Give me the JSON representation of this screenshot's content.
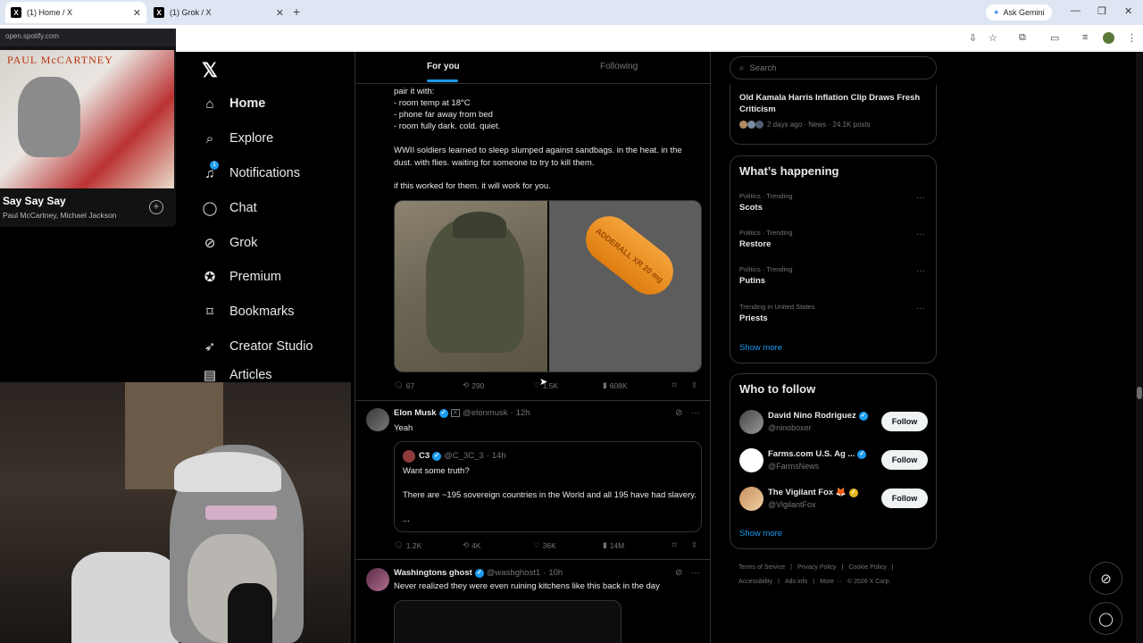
{
  "browser": {
    "tabs": [
      {
        "label": "(1) Home / X",
        "icon": "x-favicon"
      },
      {
        "label": "(1) Grok / X",
        "icon": "x-favicon"
      }
    ],
    "gemini_label": "Ask Gemini"
  },
  "spotify": {
    "url": "open.spotify.com",
    "art_text": "PAUL McCARTNEY",
    "song": "Say Say Say",
    "artist": "Paul McCartney, Michael Jackson"
  },
  "nav": {
    "items": [
      {
        "label": "Home",
        "icon": "home-icon"
      },
      {
        "label": "Explore",
        "icon": "search-icon"
      },
      {
        "label": "Notifications",
        "icon": "bell-icon",
        "badge": "1"
      },
      {
        "label": "Chat",
        "icon": "chat-icon"
      },
      {
        "label": "Grok",
        "icon": "grok-icon"
      },
      {
        "label": "Premium",
        "icon": "premium-icon"
      },
      {
        "label": "Bookmarks",
        "icon": "bookmark-icon"
      },
      {
        "label": "Creator Studio",
        "icon": "rocket-icon"
      },
      {
        "label": "Articles",
        "icon": "article-icon"
      }
    ]
  },
  "feed": {
    "tabs": {
      "foryou": "For you",
      "following": "Following"
    },
    "post1": {
      "lines": [
        "pair it with:",
        "- room temp at 18°C",
        "- phone far away from bed",
        "- room fully dark. cold. quiet."
      ],
      "para2": "WWII soldiers learned to sleep slumped against sandbags. in the heat. in the dust. with flies. waiting for someone to try to kill them.",
      "para3": "if this worked for them. it will work for you.",
      "pill_text": "ADDERALL XR 20 mg",
      "stats": {
        "replies": "67",
        "reposts": "290",
        "likes": "1.5K",
        "views": "608K"
      }
    },
    "post2": {
      "name": "Elon Musk",
      "handle": "@elonmusk",
      "time": "12h",
      "text": "Yeah",
      "quote": {
        "name": "C3",
        "handle": "@C_3C_3",
        "time": "14h",
        "line1": "Want some truth?",
        "line2": "There are ~195 sovereign countries in the World and all 195 have had slavery.",
        "line3": "..."
      },
      "stats": {
        "replies": "1.2K",
        "reposts": "4K",
        "likes": "36K",
        "views": "14M"
      }
    },
    "post3": {
      "name": "Washingtons ghost",
      "handle": "@washghost1",
      "time": "10h",
      "text": "Never realized they were even ruining kitchens like this back in the day"
    }
  },
  "right": {
    "search_placeholder": "Search",
    "news": {
      "title": "Old Kamala Harris Inflation Clip Draws Fresh Criticism",
      "meta": "2 days ago · News · 24.1K posts"
    },
    "happening": {
      "title": "What’s happening",
      "trends": [
        {
          "meta": "Politics · Trending",
          "name": "Scots"
        },
        {
          "meta": "Politics · Trending",
          "name": "Restore"
        },
        {
          "meta": "Politics · Trending",
          "name": "Putins"
        },
        {
          "meta": "Trending in United States",
          "name": "Priests"
        }
      ],
      "show_more": "Show more"
    },
    "who": {
      "title": "Who to follow",
      "users": [
        {
          "name": "David Nino Rodriguez",
          "handle": "@ninoboxer",
          "follow": "Follow"
        },
        {
          "name": "Farms.com U.S. Ag ...",
          "handle": "@FarmsNews",
          "follow": "Follow"
        },
        {
          "name": "The Vigilant Fox 🦊",
          "handle": "@VigilantFox",
          "follow": "Follow"
        }
      ],
      "show_more": "Show more"
    },
    "footer": {
      "links": [
        "Terms of Service",
        "|",
        "Privacy Policy",
        "|",
        "Cookie Policy",
        "|",
        "Accessibility",
        "|",
        "Ads info",
        "|",
        "More ···",
        "© 2026 X Corp."
      ]
    }
  }
}
